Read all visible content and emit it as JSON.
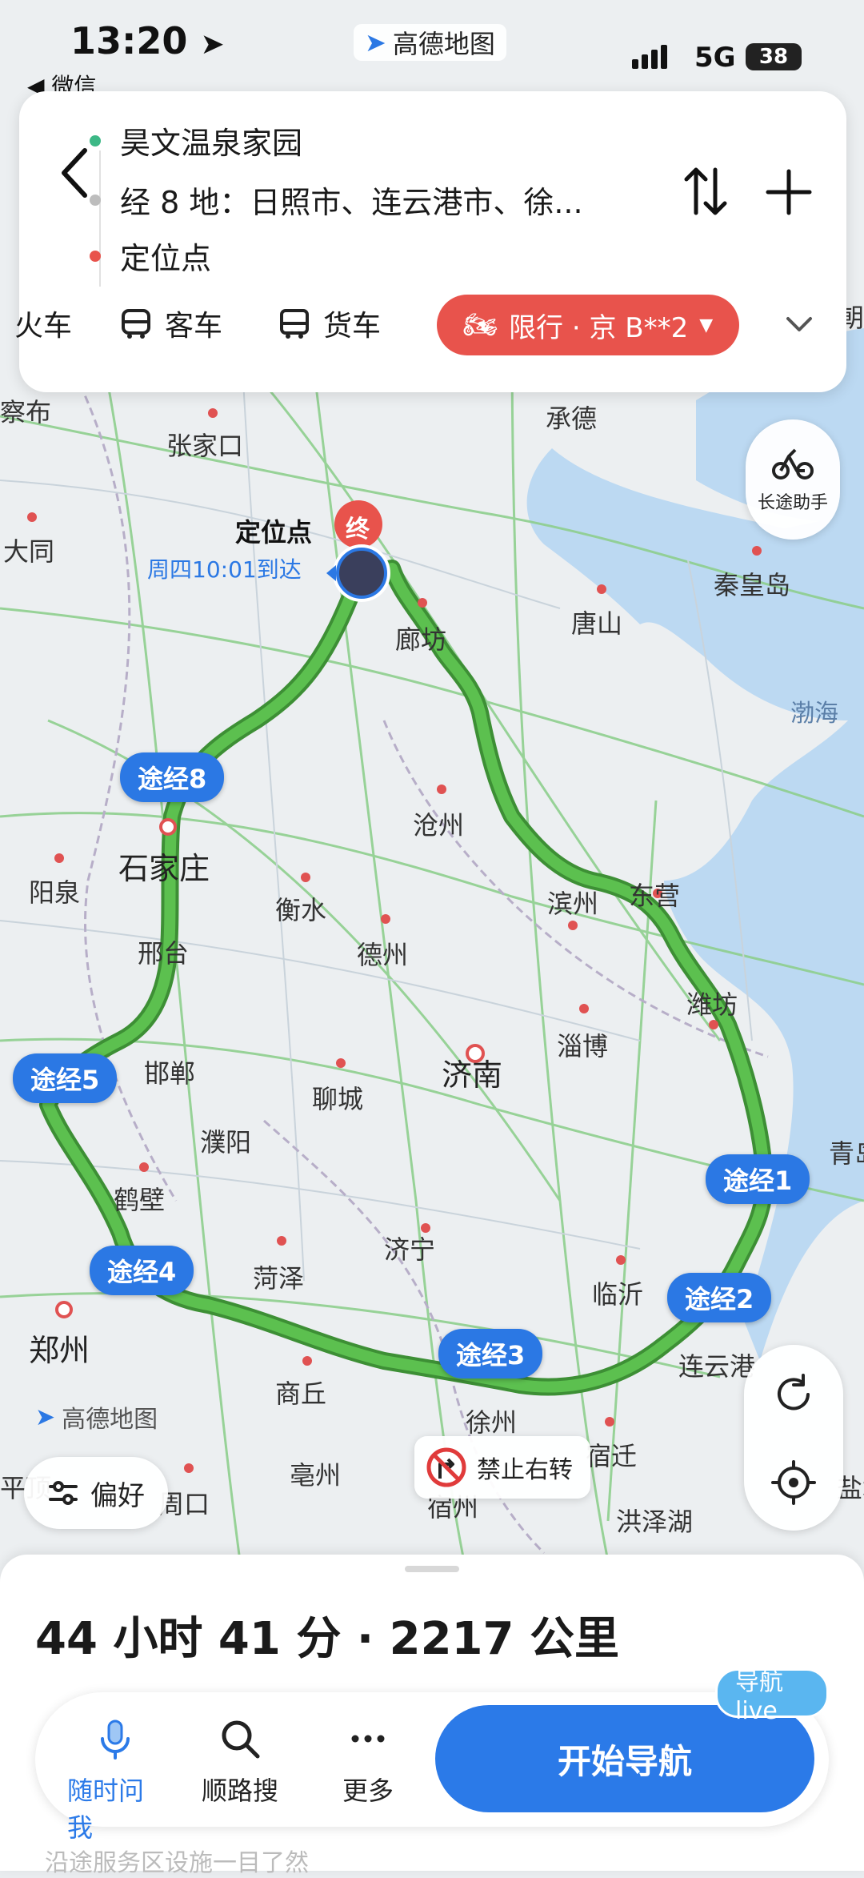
{
  "status_bar": {
    "time": "13:20",
    "back_app": "◀ 微信",
    "app_badge": "高德地图",
    "network": "5G",
    "battery": "38"
  },
  "route": {
    "origin": "昊文温泉家园",
    "waypoints": "经 8 地：日照市、连云港市、徐...",
    "destination": "定位点"
  },
  "modes": [
    {
      "label": "火车",
      "icon": "car-icon"
    },
    {
      "label": "客车",
      "icon": "bus-icon"
    },
    {
      "label": "货车",
      "icon": "truck-icon"
    }
  ],
  "restriction_chip": "限行 · 京 B**2",
  "map": {
    "destination_label": "定位点",
    "end_marker": "终",
    "eta": "周四10:01到达",
    "long_trip_assistant": "长途助手",
    "preference": "偏好",
    "no_right_turn": "禁止右转",
    "watermark": "高德地图",
    "cities": [
      {
        "name": "察布",
        "big": false
      },
      {
        "name": "张家口",
        "big": false
      },
      {
        "name": "承德",
        "big": false
      },
      {
        "name": "大同",
        "big": false
      },
      {
        "name": "廊坊",
        "big": false
      },
      {
        "name": "唐山",
        "big": false
      },
      {
        "name": "秦皇岛",
        "big": false
      },
      {
        "name": "沧州",
        "big": false
      },
      {
        "name": "石家庄",
        "big": true
      },
      {
        "name": "阳泉",
        "big": false
      },
      {
        "name": "衡水",
        "big": false
      },
      {
        "name": "德州",
        "big": false
      },
      {
        "name": "滨州",
        "big": false
      },
      {
        "name": "东营",
        "big": false
      },
      {
        "name": "邢台",
        "big": false
      },
      {
        "name": "潍坊",
        "big": false
      },
      {
        "name": "淄博",
        "big": false
      },
      {
        "name": "邯郸",
        "big": false
      },
      {
        "name": "济南",
        "big": true
      },
      {
        "name": "聊城",
        "big": false
      },
      {
        "name": "濮阳",
        "big": false
      },
      {
        "name": "青岛",
        "big": false
      },
      {
        "name": "鹤壁",
        "big": false
      },
      {
        "name": "济宁",
        "big": false
      },
      {
        "name": "菏泽",
        "big": false
      },
      {
        "name": "临沂",
        "big": false
      },
      {
        "name": "郑州",
        "big": true
      },
      {
        "name": "商丘",
        "big": false
      },
      {
        "name": "连云港",
        "big": false
      },
      {
        "name": "徐州",
        "big": false
      },
      {
        "name": "宿迁",
        "big": false
      },
      {
        "name": "亳州",
        "big": false
      },
      {
        "name": "周口",
        "big": false
      },
      {
        "name": "宿州",
        "big": false
      },
      {
        "name": "洪泽湖",
        "big": false
      },
      {
        "name": "盐城",
        "big": false
      },
      {
        "name": "平顶",
        "big": false
      },
      {
        "name": "朝",
        "big": false
      }
    ],
    "sea": "渤海",
    "via_labels": [
      "途经8",
      "途经5",
      "途经4",
      "途经3",
      "途经2",
      "途经1"
    ]
  },
  "bottom": {
    "summary": "44 小时 41 分 · 2217 公里",
    "actions": [
      {
        "label": "随时问我",
        "icon": "microphone-icon"
      },
      {
        "label": "顺路搜",
        "icon": "search-icon"
      },
      {
        "label": "更多",
        "icon": "more-icon"
      }
    ],
    "start_nav": "开始导航",
    "live_badge": "导航 live",
    "footnote": "沿途服务区设施一目了然"
  },
  "colors": {
    "route": "#4caf3f",
    "via_chip": "#2b78e4",
    "restriction": "#e8534c",
    "primary_button": "#2b7ae8"
  }
}
